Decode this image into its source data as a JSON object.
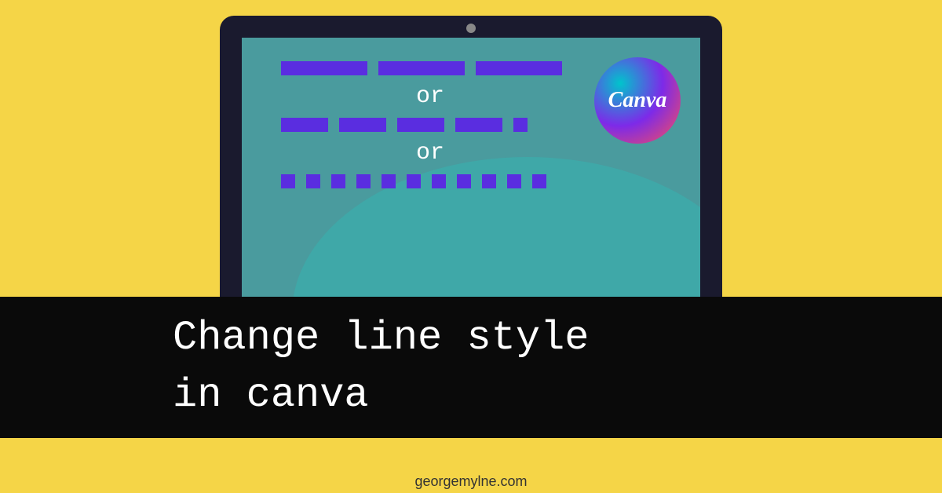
{
  "screen": {
    "or1": "or",
    "or2": "or",
    "badge": "Canva"
  },
  "title": {
    "line1": "Change line style",
    "line2": "in canva"
  },
  "footer": "georgemylne.com",
  "colors": {
    "background": "#f5d547",
    "laptop": "#1a1a2e",
    "screen": "#4a9b9e",
    "dash": "#5a2de0"
  }
}
